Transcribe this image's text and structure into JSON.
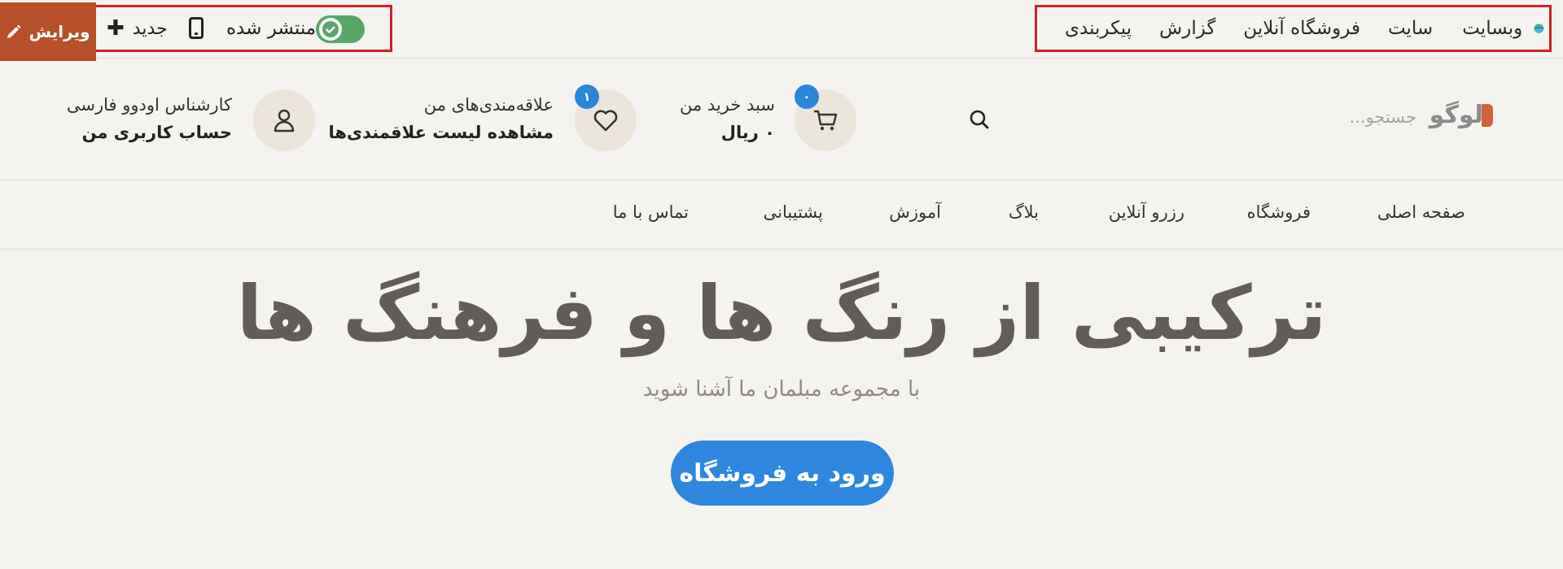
{
  "admin_bar": {
    "menu": [
      "وبسایت",
      "سایت",
      "فروشگاه آنلاین",
      "گزارش",
      "پیکربندی"
    ],
    "edit_label": "ویرایش",
    "new_label": "جدید",
    "publish_label": "منتشر شده",
    "publish_state": "on"
  },
  "header": {
    "logo_text": "لوگو",
    "search_placeholder": "جستجو...",
    "cart": {
      "title": "سبد خرید من",
      "total": "۰ ریال",
      "count": "۰"
    },
    "wishlist": {
      "title": "علاقه‌مندی‌های من",
      "link": "مشاهده لیست علاقمندی‌ها",
      "count": "۱"
    },
    "account": {
      "name": "کارشناس اودوو فارسی",
      "link": "حساب کاربری من"
    }
  },
  "nav": {
    "items": [
      "صفحه اصلی",
      "فروشگاه",
      "رزرو آنلاین",
      "بلاگ",
      "آموزش",
      "پشتیبانی",
      "تماس با ما"
    ]
  },
  "hero": {
    "title": "ترکیبی از رنگ ها و فرهنگ ها",
    "subtitle": "با مجموعه مبلمان ما آشنا شوید",
    "cta": "ورود به فروشگاه"
  },
  "colors": {
    "accent_blue": "#2e86de",
    "edit_orange": "#b5502b",
    "toggle_green": "#5aa56a",
    "highlight_red": "#d0202a"
  }
}
